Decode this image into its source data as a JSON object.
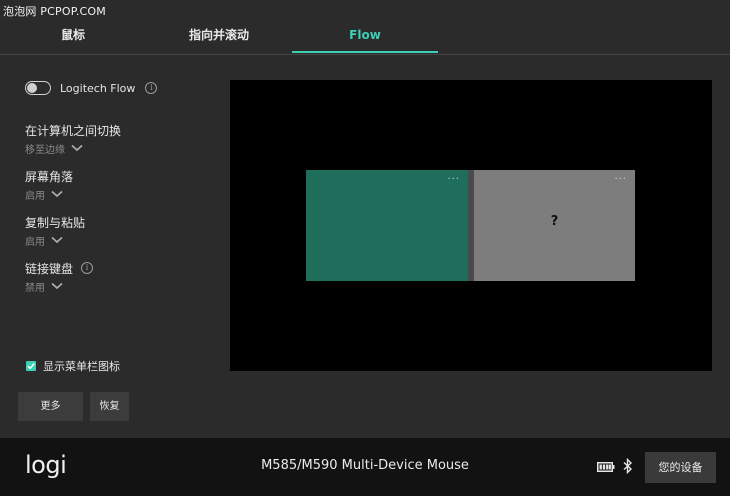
{
  "watermark": "泡泡网 PCPOP.COM",
  "tabs": [
    {
      "label": "鼠标"
    },
    {
      "label": "指向并滚动"
    },
    {
      "label": "Flow"
    }
  ],
  "flow_toggle": {
    "label": "Logitech Flow",
    "enabled": false
  },
  "settings": [
    {
      "title": "在计算机之间切换",
      "value": "移至边缘"
    },
    {
      "title": "屏幕角落",
      "value": "启用"
    },
    {
      "title": "复制与粘贴",
      "value": "启用"
    },
    {
      "title": "链接键盘",
      "value": "禁用"
    }
  ],
  "menubar_checkbox": {
    "label": "显示菜单栏图标",
    "checked": true
  },
  "buttons": {
    "more": "更多",
    "restore": "恢复"
  },
  "preview": {
    "screen_menu": "···",
    "unknown_screen": "?"
  },
  "footer": {
    "logo": "logi",
    "device_name": "M585/M590 Multi-Device Mouse",
    "devices_button": "您的设备"
  },
  "colors": {
    "accent": "#3ecfb2",
    "screen_active": "#1f6e5c",
    "screen_other": "#7d7d7d"
  }
}
